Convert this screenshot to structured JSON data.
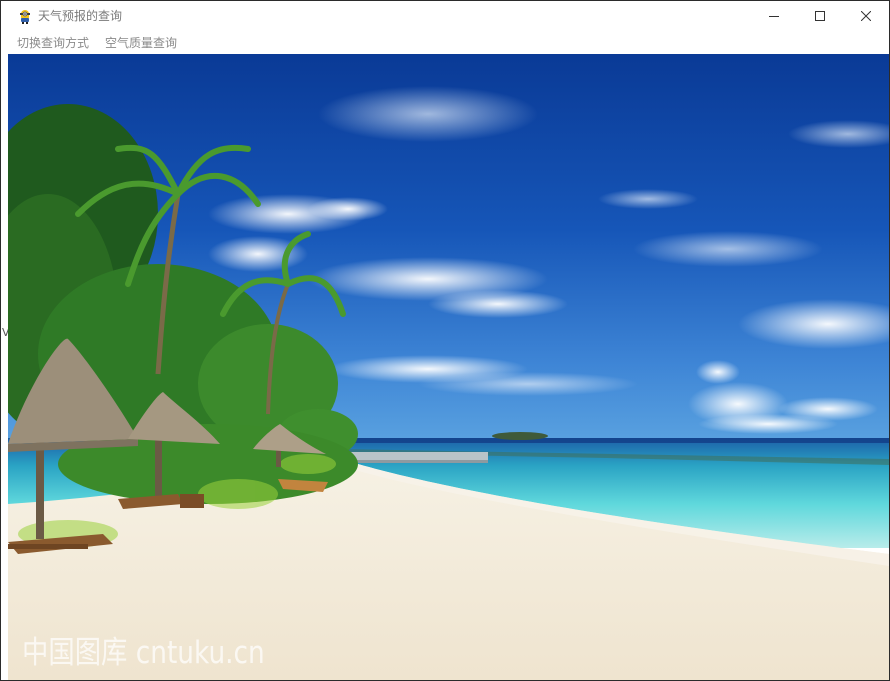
{
  "window": {
    "title": "天气预报的查询",
    "controls": {
      "minimize_icon": "minimize-icon",
      "maximize_icon": "maximize-icon",
      "close_icon": "close-icon"
    }
  },
  "menu": {
    "items": [
      {
        "label": "切换查询方式"
      },
      {
        "label": "空气质量查询"
      }
    ]
  },
  "left_edge_text": "V",
  "background_image": {
    "watermark": "中国图库 cntuku.cn"
  },
  "colors": {
    "sky_top": "#0a3d9c",
    "sky_bottom": "#3a7fd4",
    "sea": "#4fd0d8",
    "sand": "#f2ead8",
    "title_text": "#7a7a7a",
    "menu_text": "#8a8a8a"
  }
}
